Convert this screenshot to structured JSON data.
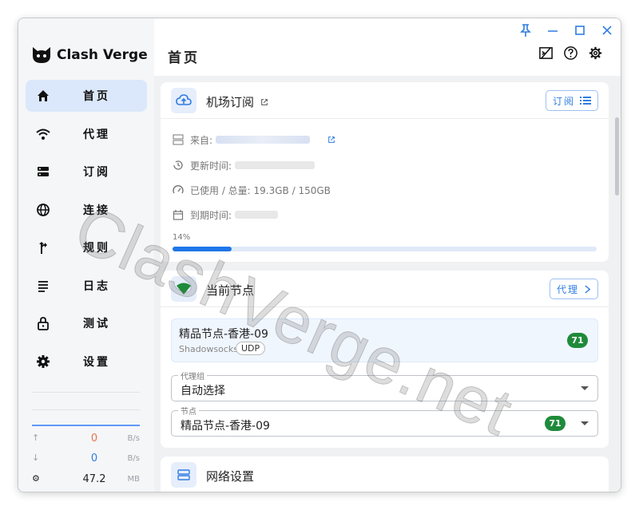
{
  "app": {
    "name": "Clash Verge"
  },
  "sidebar": {
    "items": [
      {
        "label": "首页",
        "icon": "home-icon",
        "active": true
      },
      {
        "label": "代理",
        "icon": "wifi-icon",
        "active": false
      },
      {
        "label": "订阅",
        "icon": "storage-icon",
        "active": false
      },
      {
        "label": "连接",
        "icon": "globe-icon",
        "active": false
      },
      {
        "label": "规则",
        "icon": "fork-icon",
        "active": false
      },
      {
        "label": "日志",
        "icon": "log-lines-icon",
        "active": false
      },
      {
        "label": "测试",
        "icon": "lock-icon",
        "active": false
      },
      {
        "label": "设置",
        "icon": "gear-icon",
        "active": false
      }
    ],
    "traffic": {
      "upload": {
        "value": "0",
        "unit": "B/s",
        "color": "#e8734e"
      },
      "download": {
        "value": "0",
        "unit": "B/s",
        "color": "#2f7de1"
      },
      "memory": {
        "value": "47.2",
        "unit": "MB"
      }
    }
  },
  "header": {
    "title": "首页"
  },
  "subscription": {
    "title": "机场订阅",
    "button_label": "订阅",
    "from_label": "来自:",
    "updated_label": "更新时间:",
    "usage_label": "已使用 / 总量: 19.3GB / 150GB",
    "expire_label": "到期时间:",
    "progress_label": "14%",
    "progress": 14
  },
  "current_node": {
    "title": "当前节点",
    "button_label": "代理",
    "node_name": "精品节点-香港-09",
    "protocol": "Shadowsocks",
    "udp": "UDP",
    "latency": "71",
    "group_label": "代理组",
    "group_value": "自动选择",
    "node_label": "节点",
    "node_value": "精品节点-香港-09",
    "node_latency": "71"
  },
  "network": {
    "title": "网络设置"
  },
  "watermark": "ClashVerge.net",
  "colors": {
    "accent": "#2f7de1",
    "active_nav": "#dbe8fb",
    "latency_badge": "#1f8b3a"
  }
}
